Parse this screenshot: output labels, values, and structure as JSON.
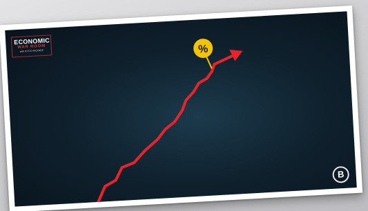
{
  "logo": {
    "line1": "ECONOMIC",
    "line2": "WAR ROOM",
    "line3": "with KITCO PICKNEE"
  },
  "badge": {
    "symbol": "%"
  },
  "brand": {
    "letter": "B"
  },
  "colors": {
    "background": "#10222f",
    "line": "#e8232a",
    "badge": "#f4c400",
    "frame": "#ffffff"
  },
  "icons": [
    "trend-arrow-icon",
    "percent-badge-icon",
    "brand-logo-icon"
  ]
}
